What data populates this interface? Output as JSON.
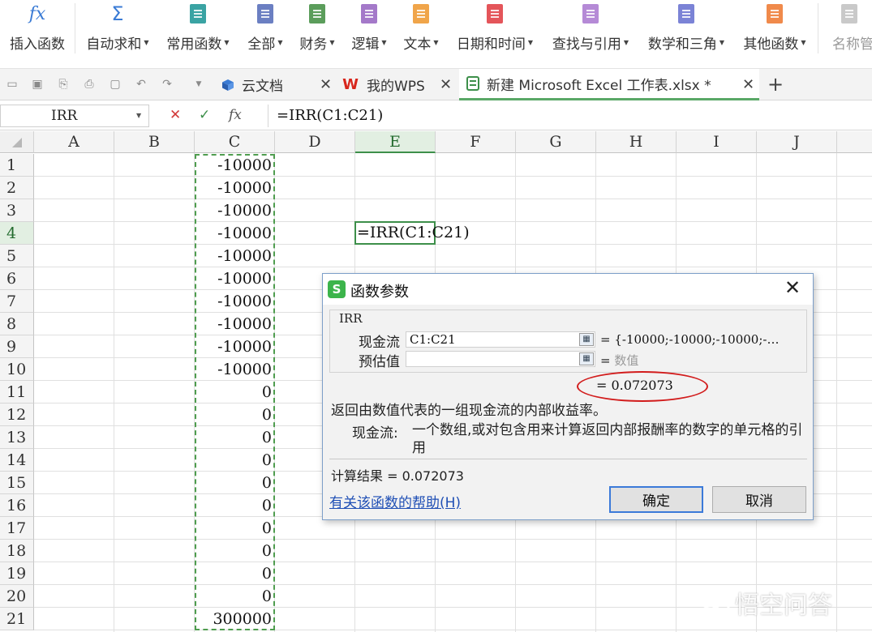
{
  "ribbon": {
    "items": [
      {
        "label": "插入函数",
        "icon": "fx-icon",
        "dropdown": false
      },
      {
        "label": "自动求和",
        "icon": "sigma-icon",
        "dropdown": true
      },
      {
        "label": "常用函数",
        "icon": "star-book-icon",
        "dropdown": true
      },
      {
        "label": "全部",
        "icon": "list-book-icon",
        "dropdown": true
      },
      {
        "label": "财务",
        "icon": "finance-book-icon",
        "dropdown": true
      },
      {
        "label": "逻辑",
        "icon": "question-book-icon",
        "dropdown": true
      },
      {
        "label": "文本",
        "icon": "text-book-icon",
        "dropdown": true
      },
      {
        "label": "日期和时间",
        "icon": "clock-book-icon",
        "dropdown": true
      },
      {
        "label": "查找与引用",
        "icon": "search-book-icon",
        "dropdown": true
      },
      {
        "label": "数学和三角",
        "icon": "theta-book-icon",
        "dropdown": true
      },
      {
        "label": "其他函数",
        "icon": "more-book-icon",
        "dropdown": true
      },
      {
        "label": "名称管",
        "icon": "name-manager-icon",
        "dropdown": false
      }
    ],
    "icon_glyphs": {
      "fx": "fx",
      "sigma": "Σ",
      "star": "★",
      "list": "≡",
      "question": "?",
      "text": "a",
      "search": "⌕",
      "theta": "θ",
      "more": "···"
    },
    "colors": {
      "fx": "#3a7bd5",
      "sigma": "#3a7bd5",
      "star": "#3aa3a3",
      "list": "#6b7fc2",
      "finance": "#5b9d5b",
      "question": "#a479c9",
      "text": "#f0a54a",
      "clock": "#e4555a",
      "search": "#b58ad6",
      "theta": "#7b83d6",
      "more": "#f08a4b"
    }
  },
  "tabbar": {
    "tabs": [
      {
        "label": "云文档",
        "icon": "cloud-cube-icon"
      },
      {
        "label": "我的WPS",
        "icon": "wps-logo-icon"
      },
      {
        "label": "新建 Microsoft Excel 工作表.xlsx *",
        "icon": "sheet-icon"
      }
    ],
    "close_glyph": "✕",
    "new_tab_glyph": "+",
    "accent": "#5aa867"
  },
  "formula_bar": {
    "name_box": "IRR",
    "cancel_glyph": "✕",
    "confirm_glyph": "✓",
    "fx_glyph": "fx",
    "formula": "=IRR(C1:C21)"
  },
  "sheet": {
    "columns": [
      "A",
      "B",
      "C",
      "D",
      "E",
      "F",
      "G",
      "H",
      "I",
      "J"
    ],
    "active_column": "E",
    "active_row": 4,
    "rows": [
      "1",
      "2",
      "3",
      "4",
      "5",
      "6",
      "7",
      "8",
      "9",
      "10",
      "11",
      "12",
      "13",
      "14",
      "15",
      "16",
      "17",
      "18",
      "19",
      "20",
      "21"
    ],
    "column_c_values": [
      "-10000",
      "-10000",
      "-10000",
      "-10000",
      "-10000",
      "-10000",
      "-10000",
      "-10000",
      "-10000",
      "-10000",
      "0",
      "0",
      "0",
      "0",
      "0",
      "0",
      "0",
      "0",
      "0",
      "0",
      "300000"
    ],
    "active_cell_text": "=IRR(C1:C21)"
  },
  "dialog": {
    "title": "函数参数",
    "function_name": "IRR",
    "args": [
      {
        "label": "现金流",
        "value": "C1:C21",
        "result": "= {-10000;-10000;-10000;-…"
      },
      {
        "label": "预估值",
        "value": "",
        "result_prefix": "=",
        "result_placeholder": "数值"
      }
    ],
    "result_display": "= 0.072073",
    "description": "返回由数值代表的一组现金流的内部收益率。",
    "arg_desc_label": "现金流:",
    "arg_desc_text": "一个数组,或对包含用来计算返回内部报酬率的数字的单元格的引用",
    "calc_result": "计算结果 = 0.072073",
    "help_link": "有关该函数的帮助(H)",
    "ok_label": "确定",
    "cancel_label": "取消",
    "close_glyph": "✕",
    "logo_letter": "S",
    "highlight_color": "#d21c1c"
  },
  "watermark": {
    "text": "悟空问答"
  }
}
